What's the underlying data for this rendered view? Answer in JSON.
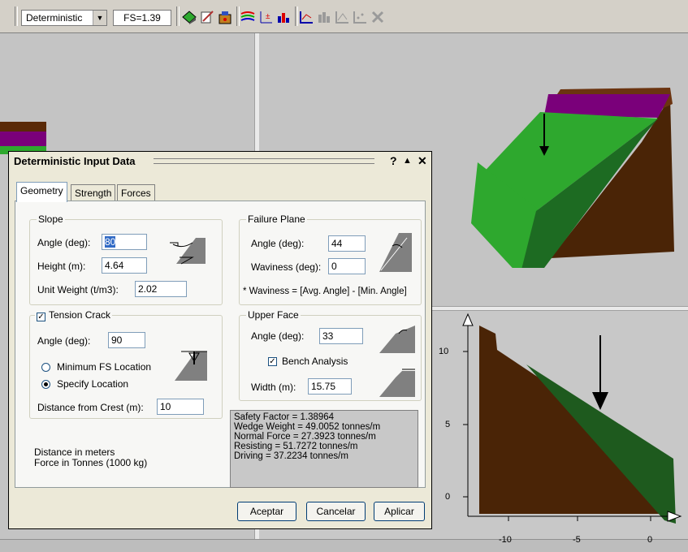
{
  "toolbar": {
    "analysis_mode": "Deterministic",
    "factor_of_safety": "FS=1.39",
    "icons": [
      "wedge-3d-icon",
      "edit-icon",
      "compute-icon",
      "contour-icon",
      "probabilistic-icon",
      "histogram-icon",
      "scatter-plot-icon",
      "bar-chart-icon",
      "sensitivity-icon",
      "scatter-icon-disabled",
      "close-plot-icon"
    ]
  },
  "dialog": {
    "title": "Deterministic Input Data",
    "help_button": "?",
    "collapse_button": "▲",
    "close_button": "✕",
    "tabs": [
      "Geometry",
      "Strength",
      "Forces"
    ],
    "active_tab": "Geometry",
    "slope": {
      "legend": "Slope",
      "angle_label": "Angle (deg):",
      "angle_value": "80",
      "height_label": "Height (m):",
      "height_value": "4.64",
      "unit_weight_label": "Unit Weight (t/m3):",
      "unit_weight_value": "2.02"
    },
    "failure_plane": {
      "legend": "Failure Plane",
      "angle_label": "Angle (deg):",
      "angle_value": "44",
      "waviness_label": "Waviness (deg):",
      "waviness_value": "0",
      "note": "* Waviness = [Avg. Angle] - [Min. Angle]"
    },
    "tension_crack": {
      "legend": "Tension Crack",
      "checked": true,
      "angle_label": "Angle (deg):",
      "angle_value": "90",
      "option_min": "Minimum FS Location",
      "option_specify": "Specify Location",
      "selected_option": "specify",
      "distance_label": "Distance from Crest (m):",
      "distance_value": "10"
    },
    "upper_face": {
      "legend": "Upper Face",
      "angle_label": "Angle (deg):",
      "angle_value": "33",
      "bench_label": "Bench Analysis",
      "bench_checked": true,
      "width_label": "Width (m):",
      "width_value": "15.75"
    },
    "units_note_1": "Distance in meters",
    "units_note_2": "Force in Tonnes (1000 kg)",
    "results": [
      "Safety Factor = 1.38964",
      "Wedge Weight = 49.0052 tonnes/m",
      "Normal Force = 27.3923 tonnes/m",
      "Resisting = 51.7272 tonnes/m",
      "Driving = 37.2234 tonnes/m"
    ],
    "buttons": {
      "ok": "Aceptar",
      "cancel": "Cancelar",
      "apply": "Aplicar"
    }
  },
  "section_plot": {
    "y_ticks": [
      "10",
      "5",
      "0"
    ],
    "x_ticks": [
      "-10",
      "-5",
      "0"
    ]
  },
  "colors": {
    "wedge_green": "#2ea82e",
    "wedge_dark_green": "#1d6b22",
    "slope_brown": "#4a2406",
    "bench_purple": "#7a007a",
    "section_green": "#1e5a1e",
    "background": "#c0c0c0"
  }
}
